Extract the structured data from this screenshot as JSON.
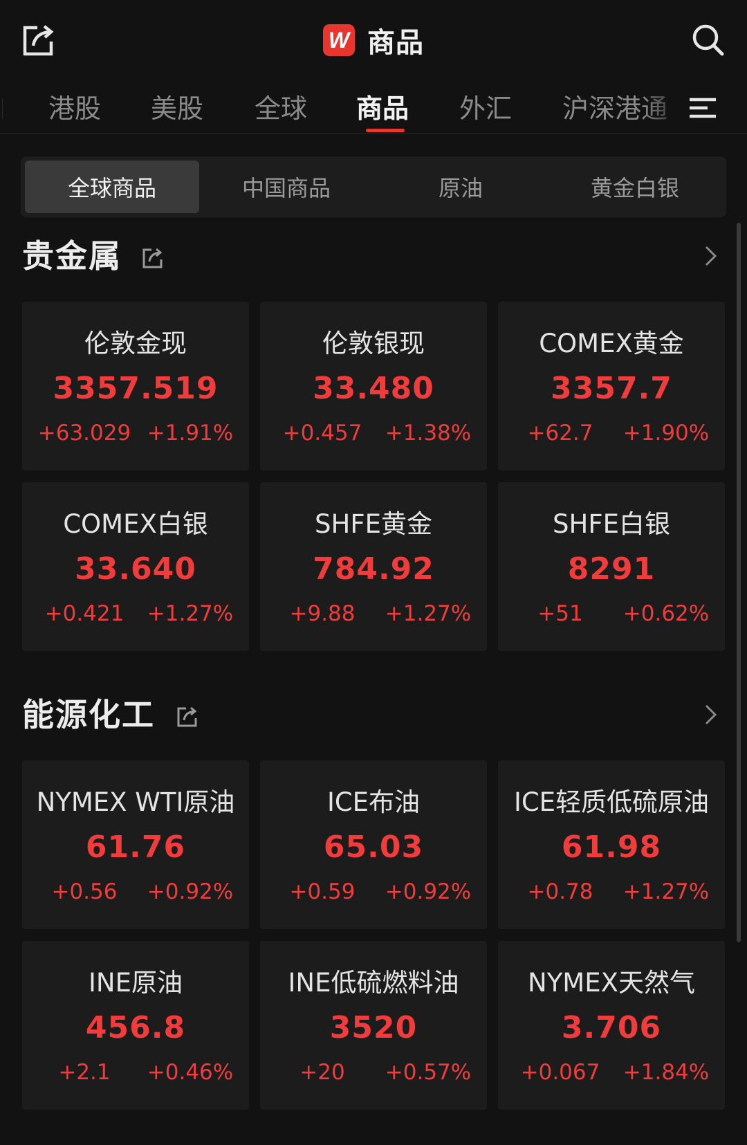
{
  "header": {
    "title": "商品",
    "logo_letter": "W",
    "accent": "#e8352e"
  },
  "tabs": [
    {
      "label": "港股"
    },
    {
      "label": "美股"
    },
    {
      "label": "全球"
    },
    {
      "label": "商品",
      "active": true
    },
    {
      "label": "外汇"
    },
    {
      "label": "沪深港通"
    }
  ],
  "segments": [
    {
      "label": "全球商品",
      "active": true
    },
    {
      "label": "中国商品"
    },
    {
      "label": "原油"
    },
    {
      "label": "黄金白银"
    }
  ],
  "sections": [
    {
      "title": "贵金属",
      "cards": [
        {
          "name": "伦敦金现",
          "price": "3357.519",
          "change": "+63.029",
          "pct": "+1.91%"
        },
        {
          "name": "伦敦银现",
          "price": "33.480",
          "change": "+0.457",
          "pct": "+1.38%"
        },
        {
          "name": "COMEX黄金",
          "price": "3357.7",
          "change": "+62.7",
          "pct": "+1.90%"
        },
        {
          "name": "COMEX白银",
          "price": "33.640",
          "change": "+0.421",
          "pct": "+1.27%"
        },
        {
          "name": "SHFE黄金",
          "price": "784.92",
          "change": "+9.88",
          "pct": "+1.27%"
        },
        {
          "name": "SHFE白银",
          "price": "8291",
          "change": "+51",
          "pct": "+0.62%"
        }
      ]
    },
    {
      "title": "能源化工",
      "cards": [
        {
          "name": "NYMEX WTI原油",
          "price": "61.76",
          "change": "+0.56",
          "pct": "+0.92%"
        },
        {
          "name": "ICE布油",
          "price": "65.03",
          "change": "+0.59",
          "pct": "+0.92%"
        },
        {
          "name": "ICE轻质低硫原油",
          "price": "61.98",
          "change": "+0.78",
          "pct": "+1.27%"
        },
        {
          "name": "INE原油",
          "price": "456.8",
          "change": "+2.1",
          "pct": "+0.46%"
        },
        {
          "name": "INE低硫燃料油",
          "price": "3520",
          "change": "+20",
          "pct": "+0.57%"
        },
        {
          "name": "NYMEX天然气",
          "price": "3.706",
          "change": "+0.067",
          "pct": "+1.84%"
        }
      ]
    }
  ],
  "colors": {
    "up": "#f23c3c",
    "background": "#121212",
    "card": "#1c1c1c"
  }
}
